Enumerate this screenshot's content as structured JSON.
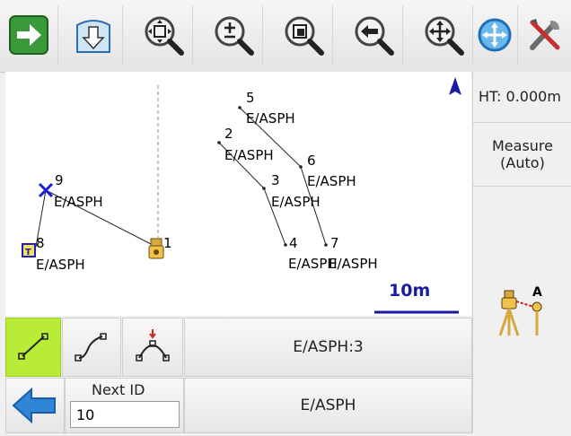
{
  "toolbar": {
    "buttons": [
      {
        "icon": "arrow-right-icon"
      },
      {
        "icon": "import-down-arrow-icon"
      },
      {
        "icon": "zoom-fit-icon"
      },
      {
        "icon": "zoom-in-out-icon"
      },
      {
        "icon": "zoom-window-icon"
      },
      {
        "icon": "zoom-previous-icon"
      },
      {
        "icon": "pan-icon"
      },
      {
        "icon": "target-crosshair-icon"
      },
      {
        "icon": "tools-settings-icon"
      }
    ]
  },
  "map": {
    "points": [
      {
        "id": "5",
        "code": "E/ASPH"
      },
      {
        "id": "2",
        "code": "E/ASPH"
      },
      {
        "id": "6",
        "code": "E/ASPH"
      },
      {
        "id": "3",
        "code": "E/ASPH"
      },
      {
        "id": "4",
        "code": "E/ASPH"
      },
      {
        "id": "7",
        "code": "E/ASPH"
      },
      {
        "id": "9",
        "code": "E/ASPH"
      },
      {
        "id": "8",
        "code": "E/ASPH"
      },
      {
        "id": "1",
        "code": ""
      }
    ],
    "scale_label": "10m"
  },
  "side": {
    "ht_label": "HT: 0.000m",
    "measure_line1": "Measure",
    "measure_line2": "(Auto)",
    "instrument_label": "A"
  },
  "bottom": {
    "current_code": "E/ASPH:3",
    "next_id_label": "Next ID",
    "next_id_value": "10",
    "code_label": "E/ASPH"
  },
  "colors": {
    "line_mode_active": "#b9ec37",
    "scale_bar": "#1a1aa8",
    "back_arrow": "#2f86d6"
  }
}
